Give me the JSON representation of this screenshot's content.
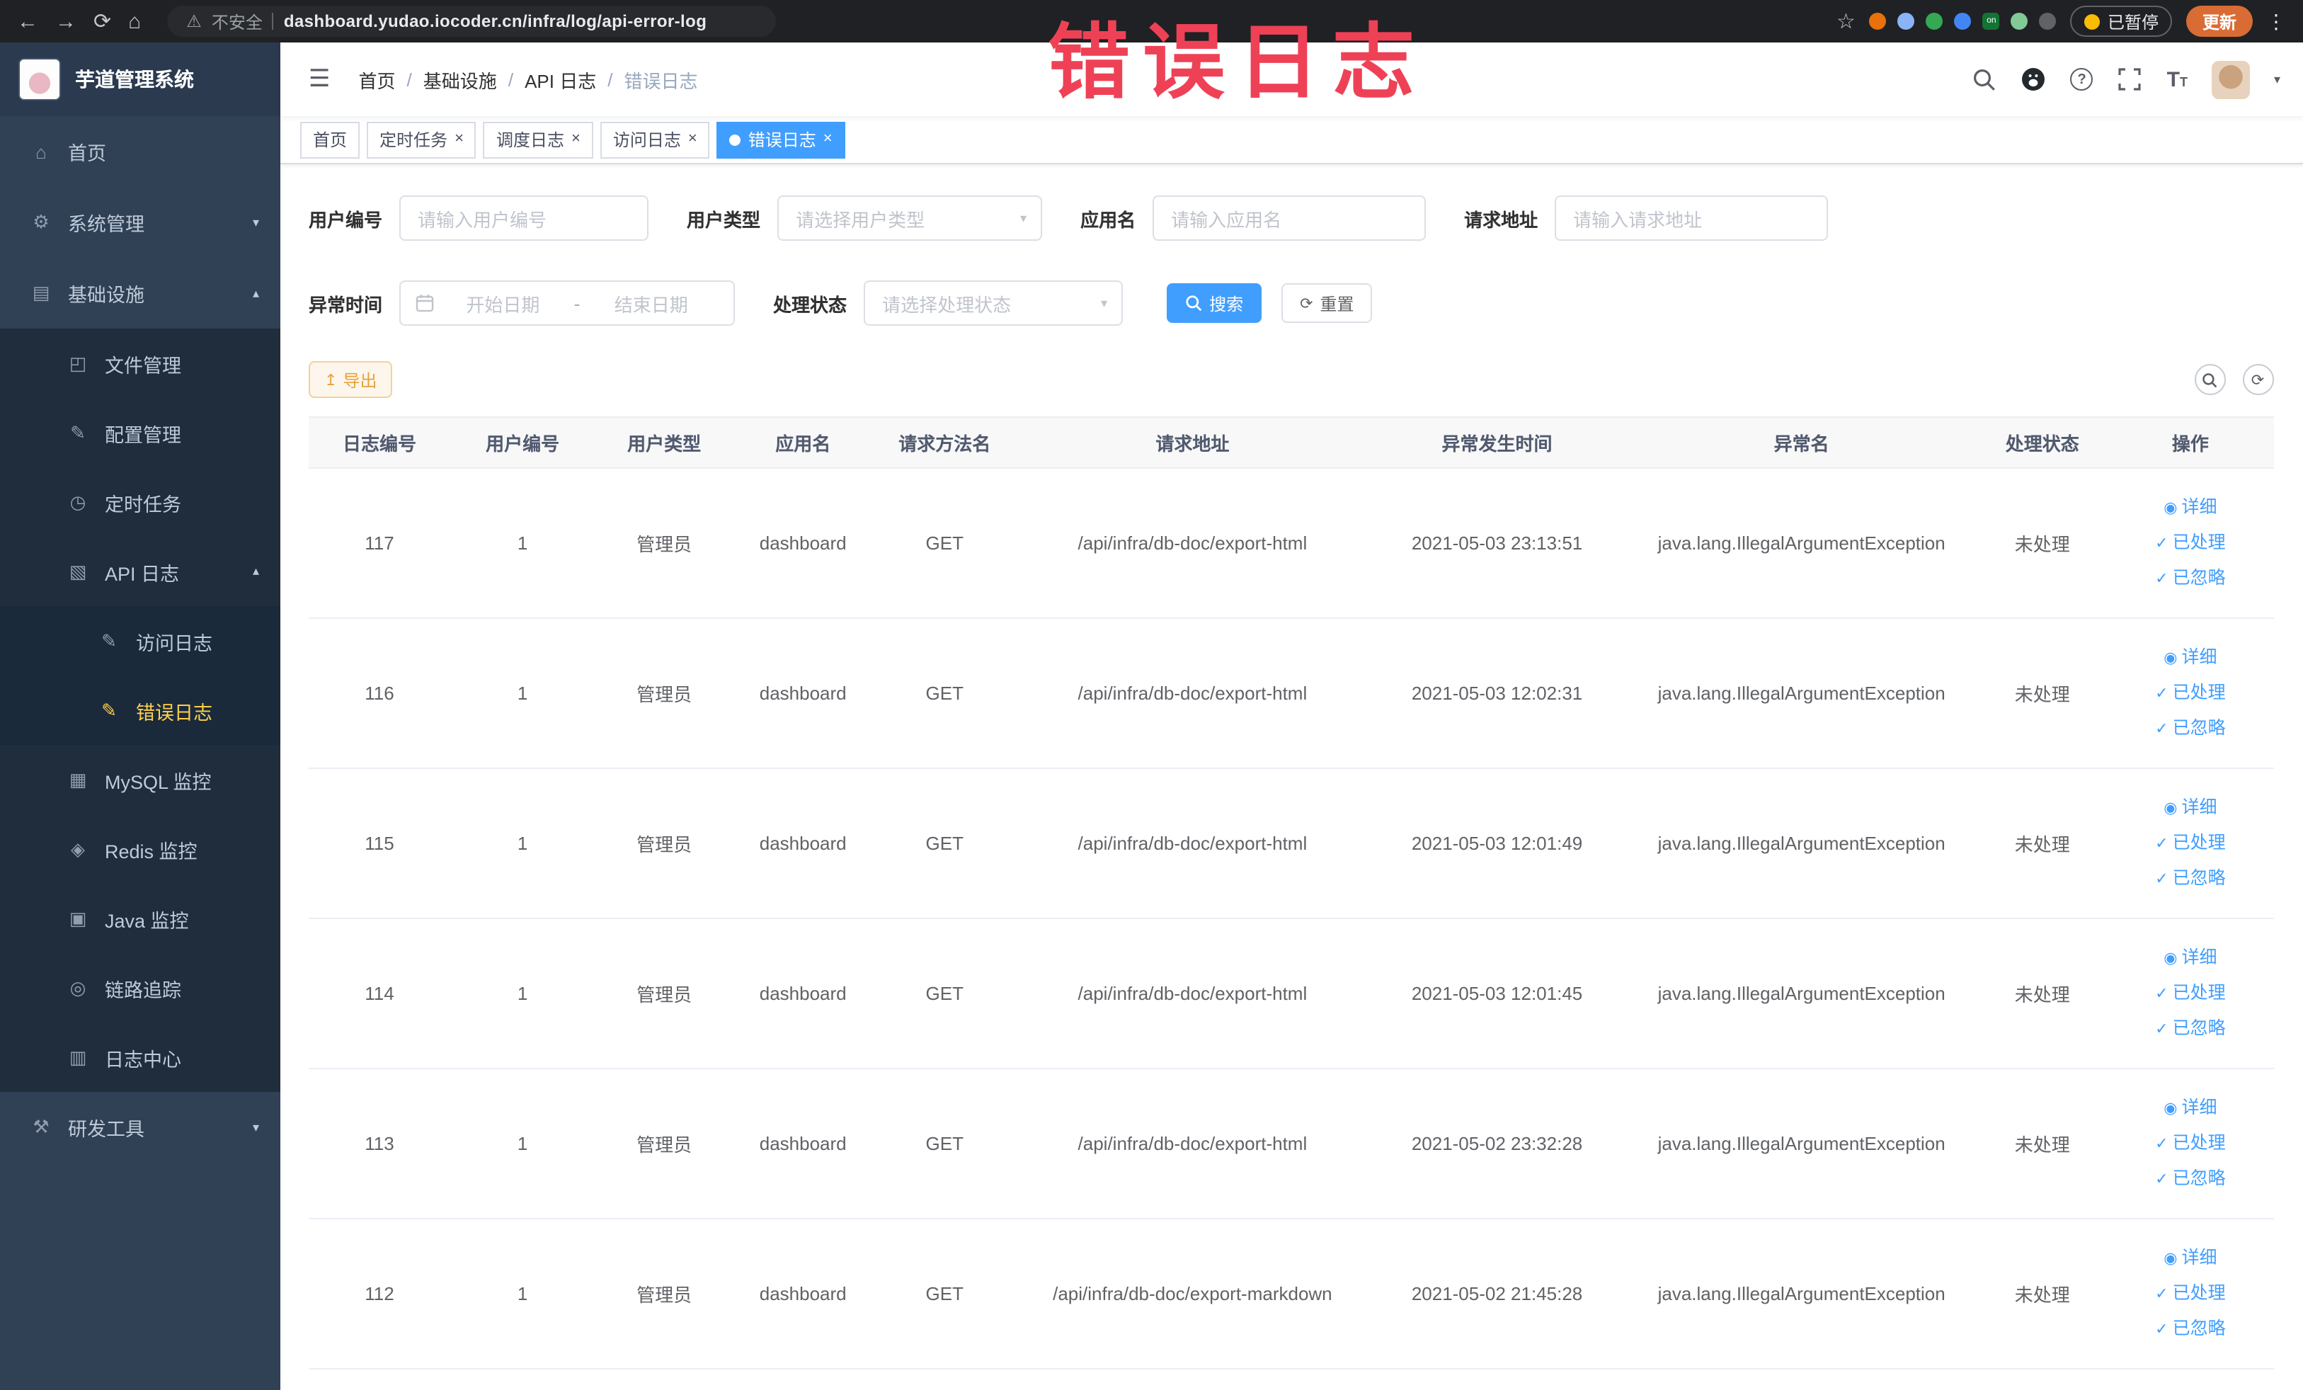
{
  "icons": {
    "back": "←",
    "forward": "→",
    "reload": "⟳",
    "home": "⌂",
    "warning": "⚠",
    "star": "☆",
    "kebab": "⋮",
    "hamburger": "☰",
    "caret_down": "▾",
    "chevron_down": "▾",
    "chevron_up": "▴",
    "check": "✓",
    "eye": "◉",
    "refresh": "⟳",
    "export_arrow": "↥",
    "close": "×"
  },
  "browser": {
    "security_label": "不安全",
    "url": "dashboard.yudao.iocoder.cn/infra/log/api-error-log",
    "paused_badge": "已暂停",
    "update_button": "更新",
    "extension_colors": [
      "#e8710a",
      "#8ab4f8",
      "#34a853",
      "#4285f4",
      "#137333",
      "#81c995",
      "#5f6368"
    ],
    "extension_on_text": "on"
  },
  "annotation": {
    "text": "错误日志",
    "color": "#ef4156"
  },
  "sidebar": {
    "logo_title": "芋道管理系统",
    "items": [
      {
        "label": "首页",
        "icon": "⌂"
      },
      {
        "label": "系统管理",
        "icon": "⚙"
      },
      {
        "label": "基础设施",
        "icon": "▤"
      },
      {
        "label": "文件管理",
        "icon": "◰"
      },
      {
        "label": "配置管理",
        "icon": "✎"
      },
      {
        "label": "定时任务",
        "icon": "◷"
      },
      {
        "label": "API 日志",
        "icon": "▧"
      },
      {
        "label": "访问日志",
        "icon": "✎"
      },
      {
        "label": "错误日志",
        "icon": "✎"
      },
      {
        "label": "MySQL 监控",
        "icon": "▦"
      },
      {
        "label": "Redis 监控",
        "icon": "◈"
      },
      {
        "label": "Java 监控",
        "icon": "▣"
      },
      {
        "label": "链路追踪",
        "icon": "◎"
      },
      {
        "label": "日志中心",
        "icon": "▥"
      },
      {
        "label": "研发工具",
        "icon": "⚒"
      }
    ]
  },
  "breadcrumb": {
    "items": [
      "首页",
      "基础设施",
      "API 日志",
      "错误日志"
    ],
    "separator": "/"
  },
  "tabs": [
    {
      "label": "首页"
    },
    {
      "label": "定时任务"
    },
    {
      "label": "调度日志"
    },
    {
      "label": "访问日志"
    },
    {
      "label": "错误日志"
    }
  ],
  "filters": {
    "user_id_label": "用户编号",
    "user_id_placeholder": "请输入用户编号",
    "user_type_label": "用户类型",
    "user_type_placeholder": "请选择用户类型",
    "app_name_label": "应用名",
    "app_name_placeholder": "请输入应用名",
    "request_url_label": "请求地址",
    "request_url_placeholder": "请输入请求地址",
    "exception_time_label": "异常时间",
    "start_date_placeholder": "开始日期",
    "date_separator": "-",
    "end_date_placeholder": "结束日期",
    "process_status_label": "处理状态",
    "process_status_placeholder": "请选择处理状态",
    "search_button": "搜索",
    "reset_button": "重置"
  },
  "toolbar": {
    "export_button": "导出"
  },
  "table": {
    "columns": [
      "日志编号",
      "用户编号",
      "用户类型",
      "应用名",
      "请求方法名",
      "请求地址",
      "异常发生时间",
      "异常名",
      "处理状态",
      "操作"
    ],
    "action_labels": {
      "detail": "详细",
      "processed": "已处理",
      "ignored": "已忽略"
    },
    "rows": [
      {
        "id": "117",
        "user_id": "1",
        "user_type": "管理员",
        "app": "dashboard",
        "method": "GET",
        "url": "/api/infra/db-doc/export-html",
        "time": "2021-05-03 23:13:51",
        "exception": "java.lang.IllegalArgumentException",
        "status": "未处理"
      },
      {
        "id": "116",
        "user_id": "1",
        "user_type": "管理员",
        "app": "dashboard",
        "method": "GET",
        "url": "/api/infra/db-doc/export-html",
        "time": "2021-05-03 12:02:31",
        "exception": "java.lang.IllegalArgumentException",
        "status": "未处理"
      },
      {
        "id": "115",
        "user_id": "1",
        "user_type": "管理员",
        "app": "dashboard",
        "method": "GET",
        "url": "/api/infra/db-doc/export-html",
        "time": "2021-05-03 12:01:49",
        "exception": "java.lang.IllegalArgumentException",
        "status": "未处理"
      },
      {
        "id": "114",
        "user_id": "1",
        "user_type": "管理员",
        "app": "dashboard",
        "method": "GET",
        "url": "/api/infra/db-doc/export-html",
        "time": "2021-05-03 12:01:45",
        "exception": "java.lang.IllegalArgumentException",
        "status": "未处理"
      },
      {
        "id": "113",
        "user_id": "1",
        "user_type": "管理员",
        "app": "dashboard",
        "method": "GET",
        "url": "/api/infra/db-doc/export-html",
        "time": "2021-05-02 23:32:28",
        "exception": "java.lang.IllegalArgumentException",
        "status": "未处理"
      },
      {
        "id": "112",
        "user_id": "1",
        "user_type": "管理员",
        "app": "dashboard",
        "method": "GET",
        "url": "/api/infra/db-doc/export-markdown",
        "time": "2021-05-02 21:45:28",
        "exception": "java.lang.IllegalArgumentException",
        "status": "未处理"
      }
    ]
  }
}
